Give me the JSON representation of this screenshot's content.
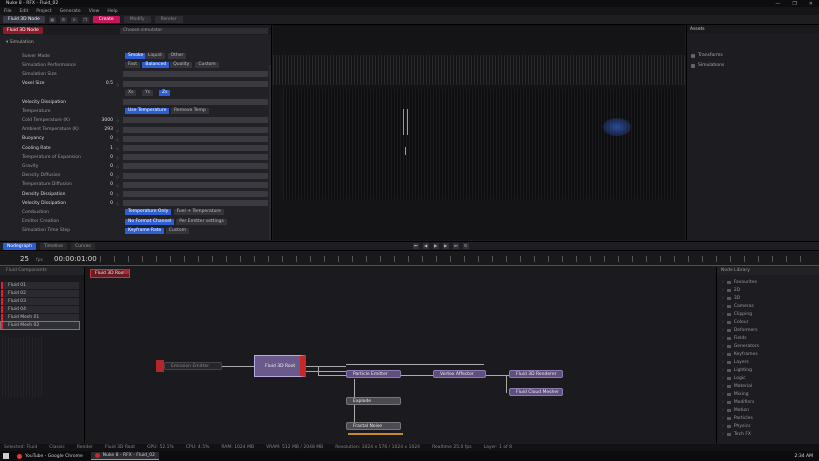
{
  "window": {
    "title": "Nuke 8 - RFX - Fluid_02",
    "controls": [
      "—",
      "❐",
      "✕"
    ]
  },
  "menu": [
    "File",
    "Edit",
    "Project",
    "Generate",
    "View",
    "Help"
  ],
  "toolbar": {
    "doc_tab": "Fluid 3D Node",
    "pills": [
      "Create",
      "Modify",
      "Render"
    ]
  },
  "inspector": {
    "node_badge": "Fluid 3D Node",
    "selector_value": "Choose simulator",
    "section": "Simulation",
    "rows": [
      {
        "label": "Solver Mode",
        "segs": [
          "Smoke",
          "Liquid",
          "Other"
        ],
        "on": 0
      },
      {
        "label": "Simulation Performance",
        "segs": [
          "Fast",
          "Balanced",
          "Quality",
          "Custom"
        ],
        "on": 1
      },
      {
        "label": "Simulation Size"
      },
      {
        "label": "Voxel Size",
        "value": "0.5",
        "bold": true
      },
      {
        "label": "",
        "segs": [
          "Xs",
          "Ys",
          "Zs"
        ],
        "on": 2
      },
      {
        "label": "Velocity Dissipation",
        "bold": true
      },
      {
        "label": "Temperature",
        "segs": [
          "Use Temperature",
          "Remove Temp"
        ],
        "on": 0
      },
      {
        "label": "Cold Temperature (K)",
        "value": "3000"
      },
      {
        "label": "Ambient Temperature (K)",
        "value": "293"
      },
      {
        "label": "Buoyancy",
        "value": "0",
        "bold": true
      },
      {
        "label": "Cooling Rate",
        "value": "1",
        "bold": true
      },
      {
        "label": "Temperature of Expansion",
        "value": "0"
      },
      {
        "label": "Gravity",
        "value": "0"
      },
      {
        "label": "Density Diffusion",
        "value": "0"
      },
      {
        "label": "Temperature Diffusion",
        "value": "0"
      },
      {
        "label": "Density Dissipation",
        "value": "0",
        "bold": true
      },
      {
        "label": "Velocity Dissipation",
        "value": "0",
        "bold": true
      },
      {
        "label": "Combustion",
        "segs": [
          "Temperature Only",
          "Fuel + Temperature"
        ],
        "on": 0
      },
      {
        "label": "Emitter Creation",
        "segs": [
          "No Format Channel",
          "Per Emitter settings"
        ],
        "on": 0
      },
      {
        "label": "Simulation Time Step",
        "segs": [
          "Keyframe Rate",
          "Custom"
        ],
        "on": 0
      }
    ]
  },
  "assets": {
    "header": "Assets",
    "items": [
      "Transforms",
      "Simulations"
    ]
  },
  "transport": {
    "tabs": [
      "Nodegraph",
      "Timeline",
      "Curves"
    ],
    "active_tab": "Nodegraph"
  },
  "ruler": {
    "frame": "25",
    "fps": "fps",
    "timecode": "00:00:01:00"
  },
  "layers": {
    "header": "Fluid Components",
    "items": [
      "Fluid 01",
      "Fluid 02",
      "Fluid 03",
      "Fluid 04",
      "Fluid Mesh 01",
      "Fluid Mesh 02"
    ],
    "selected": 5
  },
  "graph": {
    "breadcrumb": "Fluid 3D Root",
    "nodes": {
      "input": "Emission Emitter",
      "main": "Fluid 3D Root",
      "particle": "Particle Emitter",
      "vortex": "Vortex Affector",
      "render": "Fluid 3D Renderer",
      "mesher": "Fluid Cloud Mesher",
      "explode": "Explode",
      "noise": "Fractal Noise"
    }
  },
  "library": {
    "header": "Node Library",
    "items": [
      "Favourites",
      "2D",
      "3D",
      "Cameras",
      "Clipping",
      "Colour",
      "Deformers",
      "Fields",
      "Generators",
      "Keyframes",
      "Layers",
      "Lighting",
      "Logic",
      "Material",
      "Mixing",
      "Modifiers",
      "Motion",
      "Particles",
      "Physics",
      "Tech FX"
    ]
  },
  "status": [
    "Selected: Fluid",
    "Classic",
    "Render",
    "Fluid 3D Root",
    "GPU: 52.1%",
    "CPU: 4.5%",
    "RAM: 1024 MB",
    "VRAM: 512 MB / 2048 MB",
    "Resolution: 1024 x 576 / 1024 x 1024",
    "Realtime 25.0 fps",
    "Layer: 1 of 8"
  ],
  "taskbar": {
    "items": [
      "YouTube - Google Chrome",
      "Nuke 8 - RFX - Fluid_02"
    ],
    "active": 1,
    "clock": "2:34 AM"
  },
  "colors": {
    "accent": "#c2185b",
    "selected": "#2d5fd3",
    "node": "#5e4f80",
    "error": "#b3262e"
  }
}
